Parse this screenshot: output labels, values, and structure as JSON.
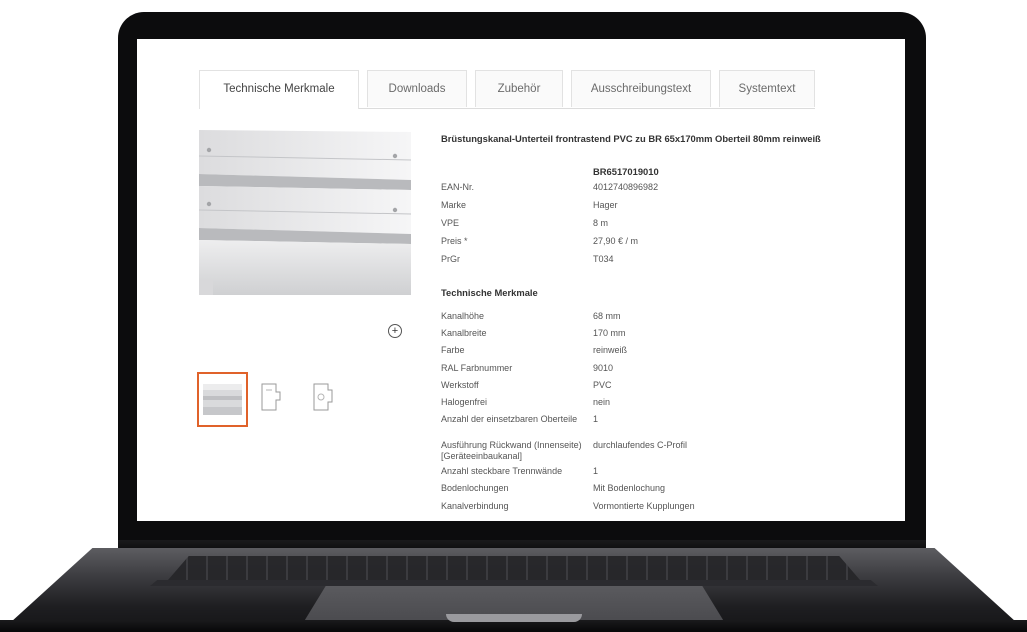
{
  "tabs": [
    {
      "label": "Technische Merkmale",
      "active": true
    },
    {
      "label": "Downloads",
      "active": false
    },
    {
      "label": "Zubehör",
      "active": false
    },
    {
      "label": "Ausschreibungstext",
      "active": false
    },
    {
      "label": "Systemtext",
      "active": false
    }
  ],
  "product": {
    "title": "Brüstungskanal-Unterteil frontrastend PVC zu BR 65x170mm Oberteil 80mm reinweiß",
    "article_number": "BR6517019010",
    "info": [
      {
        "label": "EAN-Nr.",
        "value": "4012740896982"
      },
      {
        "label": "Marke",
        "value": "Hager"
      },
      {
        "label": "VPE",
        "value": "8 m"
      },
      {
        "label": "Preis *",
        "value": "27,90 € / m"
      },
      {
        "label": "PrGr",
        "value": "T034"
      }
    ]
  },
  "tech_section_title": "Technische Merkmale",
  "tech": [
    {
      "label": "Kanalhöhe",
      "value": "68 mm"
    },
    {
      "label": "Kanalbreite",
      "value": "170 mm"
    },
    {
      "label": "Farbe",
      "value": "reinweiß"
    },
    {
      "label": "RAL Farbnummer",
      "value": "9010"
    },
    {
      "label": "Werkstoff",
      "value": "PVC"
    },
    {
      "label": "Halogenfrei",
      "value": "nein"
    },
    {
      "label": "Anzahl der einsetzbaren Oberteile",
      "value": "1"
    },
    {
      "label": "Ausführung Rückwand (Innenseite) [Geräteeinbaukanal]",
      "value": "durchlaufendes C-Profil"
    },
    {
      "label": "Anzahl steckbare Trennwände",
      "value": "1"
    },
    {
      "label": "Bodenlochungen",
      "value": "Mit Bodenlochung"
    },
    {
      "label": "Kanalverbindung",
      "value": "Vormontierte Kupplungen"
    }
  ],
  "icons": {
    "zoom": "zoom-in-icon"
  },
  "colors": {
    "accent": "#e0622a",
    "text": "#555555"
  }
}
